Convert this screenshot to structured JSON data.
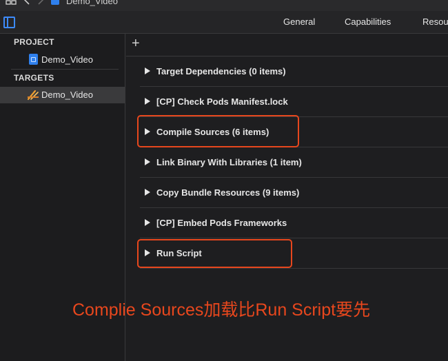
{
  "breadcrumb": {
    "project_name": "Demo_Video"
  },
  "editor_tabs": [
    "General",
    "Capabilities",
    "Resou"
  ],
  "sidebar": {
    "project_header": "PROJECT",
    "project_item": "Demo_Video",
    "targets_header": "TARGETS",
    "target_item": "Demo_Video"
  },
  "build_phases": [
    "Target Dependencies (0 items)",
    "[CP] Check Pods Manifest.lock",
    "Compile Sources (6 items)",
    "Link Binary With Libraries (1 item)",
    "Copy Bundle Resources (9 items)",
    "[CP] Embed Pods Frameworks",
    "Run Script"
  ],
  "add_button": "+",
  "annotation": "Complie Sources加载比Run Script要先",
  "colors": {
    "accent": "#3d8bfd",
    "highlight": "#e8471d"
  }
}
